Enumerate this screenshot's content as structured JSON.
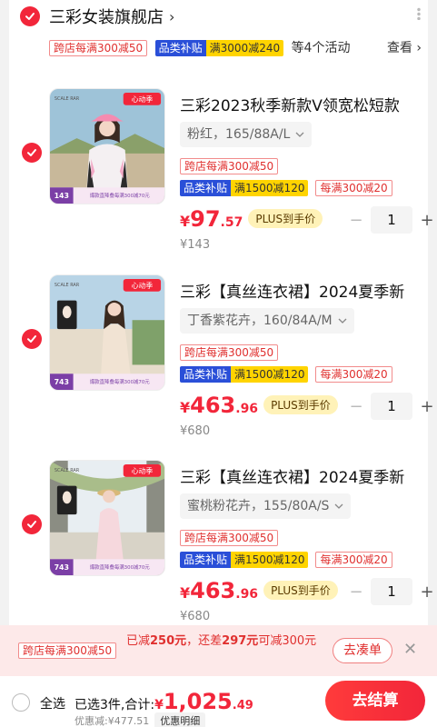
{
  "store": {
    "name": "三彩女装旗舰店",
    "chevron": "›",
    "promo": {
      "tag_cross": "跨店每满300减50",
      "tag_cat_label": "品类补贴",
      "tag_cat_value": "满3000减240",
      "more_text": "等4个活动",
      "see_more": "查看 ›"
    }
  },
  "items": [
    {
      "title": "三彩2023秋季新款V领宽松短款",
      "variant": "粉红，165/88A/L",
      "tag_cross": "跨店每满300减50",
      "tag_cat_label": "品类补贴",
      "tag_cat_value": "满1500减120",
      "tag_store": "每满300减20",
      "price_symbol": "¥",
      "price_int": "97",
      "price_dec": ".57",
      "plus": "PLUS到手价",
      "orig_price": "¥143",
      "qty": "1",
      "thumb_badge": "心动季",
      "thumb_price": "143",
      "thumb_footer": "爆款直降叠每满300减70元",
      "thumb_brand": "SCALE RAR"
    },
    {
      "title": "三彩【真丝连衣裙】2024夏季新",
      "variant": "丁香紫花卉，160/84A/M",
      "tag_cross": "跨店每满300减50",
      "tag_cat_label": "品类补贴",
      "tag_cat_value": "满1500减120",
      "tag_store": "每满300减20",
      "price_symbol": "¥",
      "price_int": "463",
      "price_dec": ".96",
      "plus": "PLUS到手价",
      "orig_price": "¥680",
      "qty": "1",
      "thumb_badge": "心动季",
      "thumb_price": "743",
      "thumb_footer": "爆款直降叠每满300减70元",
      "thumb_brand": "SCALE RAR"
    },
    {
      "title": "三彩【真丝连衣裙】2024夏季新",
      "variant": "蜜桃粉花卉，155/80A/S",
      "tag_cross": "跨店每满300减50",
      "tag_cat_label": "品类补贴",
      "tag_cat_value": "满1500减120",
      "tag_store": "每满300减20",
      "price_symbol": "¥",
      "price_int": "463",
      "price_dec": ".96",
      "plus": "PLUS到手价",
      "orig_price": "¥680",
      "qty": "1",
      "thumb_badge": "心动季",
      "thumb_price": "743",
      "thumb_footer": "爆款直降叠每满300减70元",
      "thumb_brand": "SCALE RAR"
    }
  ],
  "coupon_bar": {
    "tag": "跨店每满300减50",
    "text_a": "已减",
    "text_b": "250元",
    "text_c": "，还差",
    "text_d": "297元",
    "text_e": "可减300元",
    "button": "去凑单",
    "close": "✕"
  },
  "footer": {
    "select_all": "全选",
    "summary": "已选3件,合计:",
    "total_symbol": "¥",
    "total_int": "1,025",
    "total_dec": ".49",
    "discount": "优惠减:¥477.51",
    "discount_detail": "优惠明细",
    "checkout": "去结算"
  },
  "colors": {
    "accent": "#f2263a",
    "promo_blue": "#2a4fd8",
    "promo_yellow": "#ffd400"
  }
}
